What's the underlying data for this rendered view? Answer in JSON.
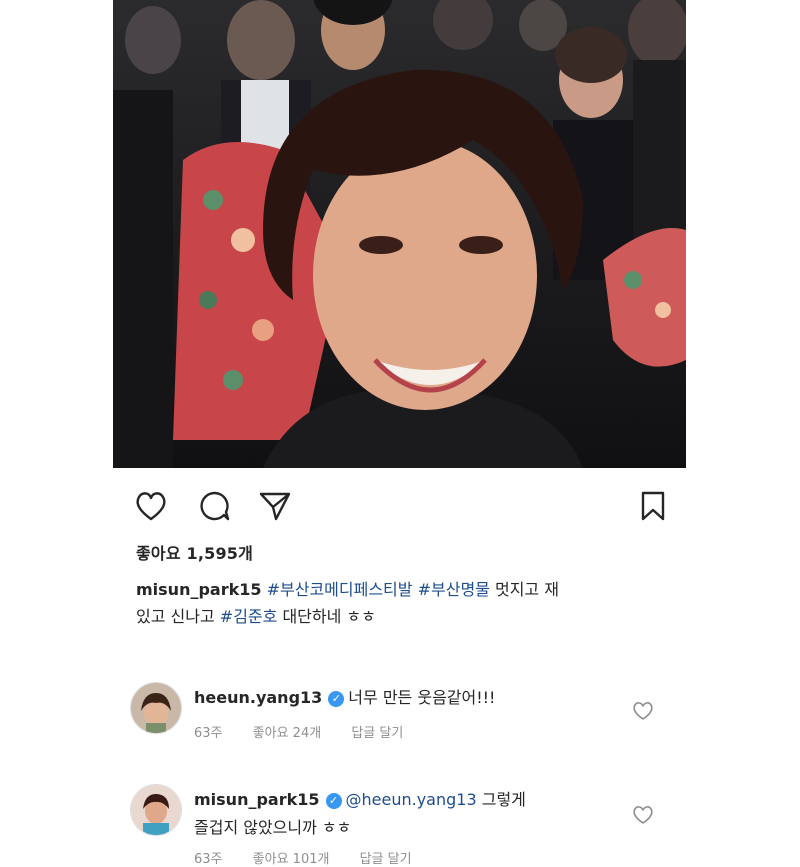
{
  "post": {
    "likes_label": "좋아요 1,595개",
    "caption": {
      "username": "misun_park15",
      "tag1": "#부산코메디페스티발",
      "tag2": "#부산명물",
      "text1": "멋지고 재",
      "text2": "있고 신나고",
      "tag3": "#김준호",
      "text3": "대단하네 ㅎㅎ"
    }
  },
  "actions": {
    "like_icon": "heart-icon",
    "comment_icon": "comment-icon",
    "share_icon": "send-icon",
    "save_icon": "bookmark-icon"
  },
  "comments": [
    {
      "username": "heeun.yang13",
      "text": "너무 만든 웃음같어!!!",
      "time": "63주",
      "likes": "좋아요 24개",
      "reply": "답글 달기"
    },
    {
      "username": "misun_park15",
      "mention": "@heeun.yang13",
      "text": "그렇게",
      "text_line2": "즐겁지 않았으니까 ㅎㅎ",
      "time": "63주",
      "likes": "좋아요 101개",
      "reply": "답글 달기"
    }
  ],
  "colors": {
    "hashtag": "#1e4d8f",
    "verified": "#3897f0",
    "meta": "#8e8e8e"
  }
}
